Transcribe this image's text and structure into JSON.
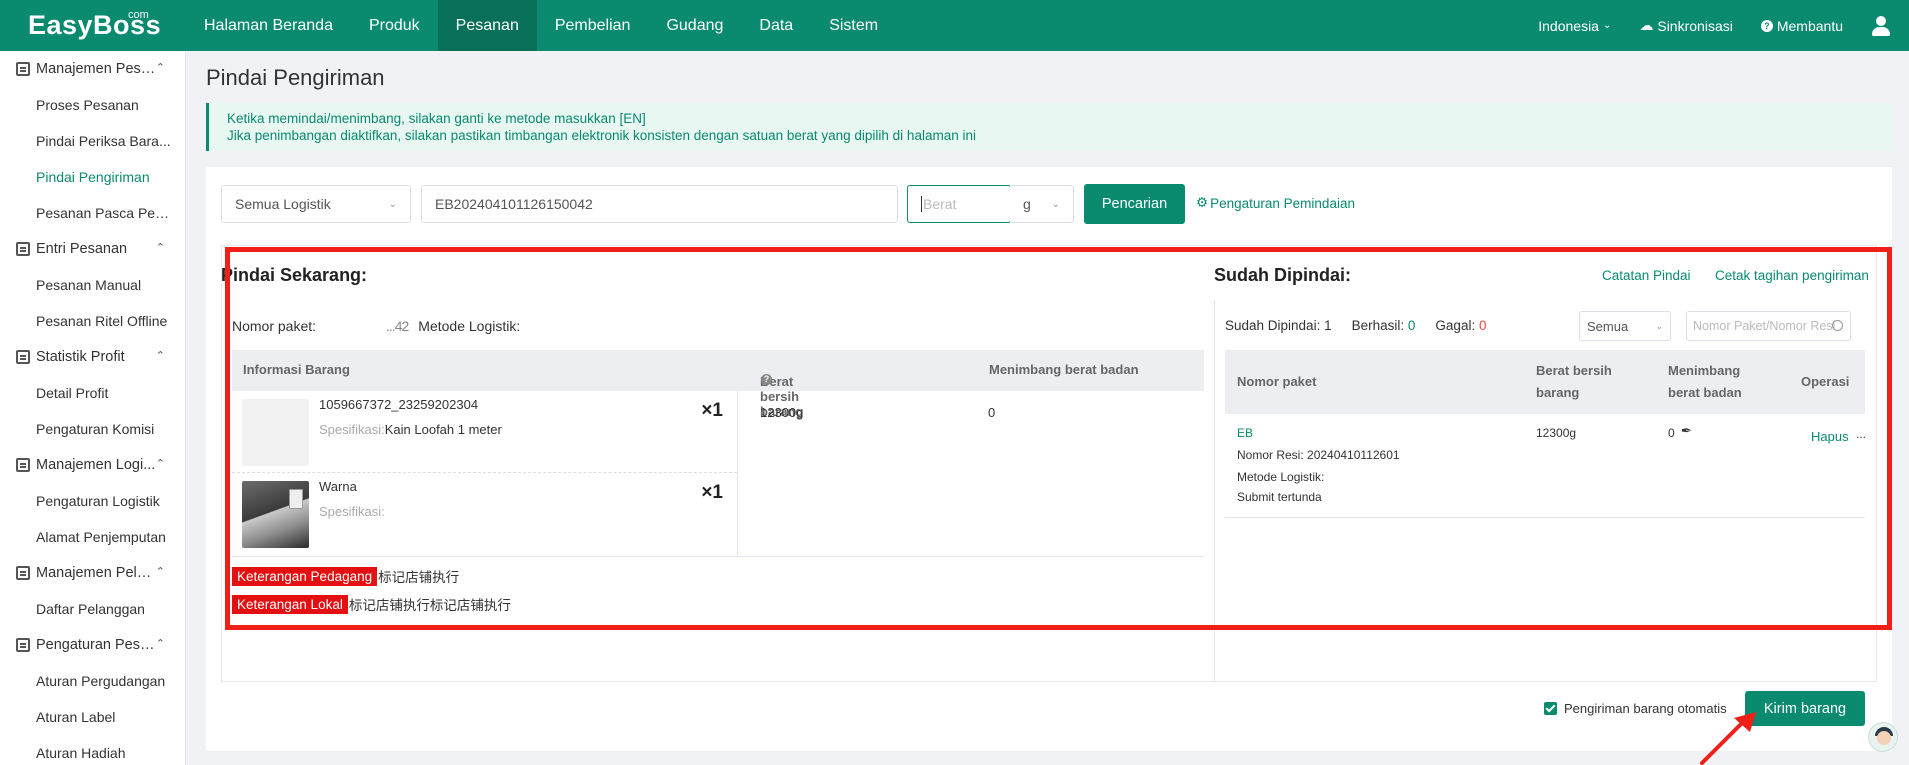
{
  "header": {
    "logo": "EasyBoss",
    "logo_suffix": "com",
    "nav": [
      "Halaman Beranda",
      "Produk",
      "Pesanan",
      "Pembelian",
      "Gudang",
      "Data",
      "Sistem"
    ],
    "active_nav": "Pesanan",
    "language": "Indonesia",
    "sync": "Sinkronisasi",
    "help": "Membantu"
  },
  "sidebar": [
    {
      "group": "Manajemen Pesa...",
      "items": [
        "Proses Pesanan",
        "Pindai Periksa Bara...",
        "Pindai Pengiriman",
        "Pesanan Pasca Penj..."
      ]
    },
    {
      "group": "Entri Pesanan",
      "items": [
        "Pesanan Manual",
        "Pesanan Ritel Offline"
      ]
    },
    {
      "group": "Statistik Profit",
      "items": [
        "Detail Profit",
        "Pengaturan Komisi"
      ]
    },
    {
      "group": "Manajemen Logi...",
      "items": [
        "Pengaturan Logistik",
        "Alamat Penjemputan"
      ]
    },
    {
      "group": "Manajemen Pela...",
      "items": [
        "Daftar Pelanggan"
      ]
    },
    {
      "group": "Pengaturan Pesa...",
      "items": [
        "Aturan Pergudangan",
        "Aturan Label",
        "Aturan Hadiah"
      ]
    }
  ],
  "sidebar_active_item": "Pindai Pengiriman",
  "page": {
    "title": "Pindai Pengiriman",
    "notice_line1": "Ketika memindai/menimbang, silakan ganti ke metode masukkan [EN]",
    "notice_line2": "Jika penimbangan diaktifkan, silakan pastikan timbangan elektronik konsisten dengan satuan berat yang dipilih di halaman ini"
  },
  "toolbar": {
    "logistic_select": "Semua Logistik",
    "order_input_value": "EB202404101126150042",
    "weight_placeholder": "Berat",
    "unit_select": "g",
    "search_button": "Pencarian",
    "scan_settings_link": "Pengaturan Pemindaian"
  },
  "scan_now": {
    "title": "Pindai Sekarang:",
    "package_label": "Nomor paket:",
    "package_value_obscured": "...42",
    "logistic_method_label": "Metode Logistik:",
    "columns": [
      "Informasi Barang",
      "Berat bersih barang",
      "Menimbang berat badan"
    ],
    "spec_label": "Spesifikasi:",
    "items": [
      {
        "name": "1059667372_23259202304",
        "spec": "Kain Loofah 1 meter",
        "qty": "×1"
      },
      {
        "name": "Warna",
        "spec": "",
        "qty": "×1"
      }
    ],
    "net_weight": "12300g",
    "weighed": "0",
    "remarks": [
      {
        "tag": "Keterangan Pedagang",
        "text": "标记店铺执行"
      },
      {
        "tag": "Keterangan Lokal",
        "text": "标记店铺执行标记店铺执行"
      }
    ]
  },
  "scanned": {
    "title": "Sudah Dipindai:",
    "log_link": "Catatan Pindai",
    "print_link": "Cetak tagihan pengiriman",
    "stat_scanned_label": "Sudah Dipindai:",
    "stat_scanned": "1",
    "stat_success_label": "Berhasil:",
    "stat_success": "0",
    "stat_fail_label": "Gagal:",
    "stat_fail": "0",
    "filter_select": "Semua",
    "search_placeholder": "Nomor Paket/Nomor Resi",
    "columns": [
      "Nomor paket",
      "Berat bersih barang",
      "Menimbang berat badan",
      "Operasi"
    ],
    "row": {
      "package": "EB",
      "resi": "Nomor Resi: 20240410112601",
      "logistic": "Metode Logistik:",
      "status": "Submit tertunda",
      "net_weight": "12300g",
      "weighed": "0",
      "action": "Hapus",
      "more": "..."
    }
  },
  "footer": {
    "auto_ship_label": "Pengiriman barang otomatis",
    "auto_ship_checked": true,
    "send_button": "Kirim barang"
  },
  "colors": {
    "brand": "#0a8a6f",
    "highlight": "#f02018",
    "remark_tag": "#e40f10",
    "fail": "#f24b4b"
  }
}
